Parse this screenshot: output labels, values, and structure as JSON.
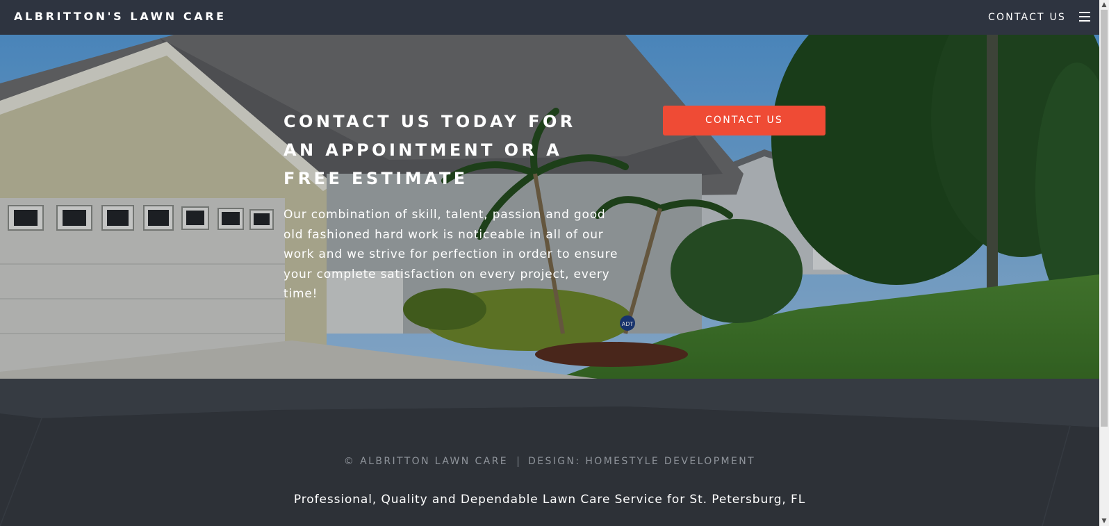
{
  "header": {
    "brand": "ALBRITTON'S LAWN CARE",
    "nav_contact": "CONTACT US",
    "menu_icon": "hamburger-menu-icon"
  },
  "hero": {
    "title": "CONTACT US TODAY FOR AN APPOINTMENT OR A FREE ESTIMATE",
    "text": "Our combination of skill, talent, passion and good old fashioned hard work is noticeable in all of our work and we strive for perfection in order to ensure your complete satisfaction on every project, every time!",
    "cta_label": "CONTACT US",
    "sign_label": "ADT"
  },
  "footer": {
    "copyright": "© ALBRITTON LAWN CARE",
    "design": "DESIGN: HOMESTYLE DEVELOPMENT",
    "tagline": "Professional, Quality and Dependable Lawn Care Service for St. Petersburg, FL"
  },
  "colors": {
    "header_bg": "#2e3440",
    "cta": "#ef4b35",
    "footer_bg": "#2d3137"
  }
}
